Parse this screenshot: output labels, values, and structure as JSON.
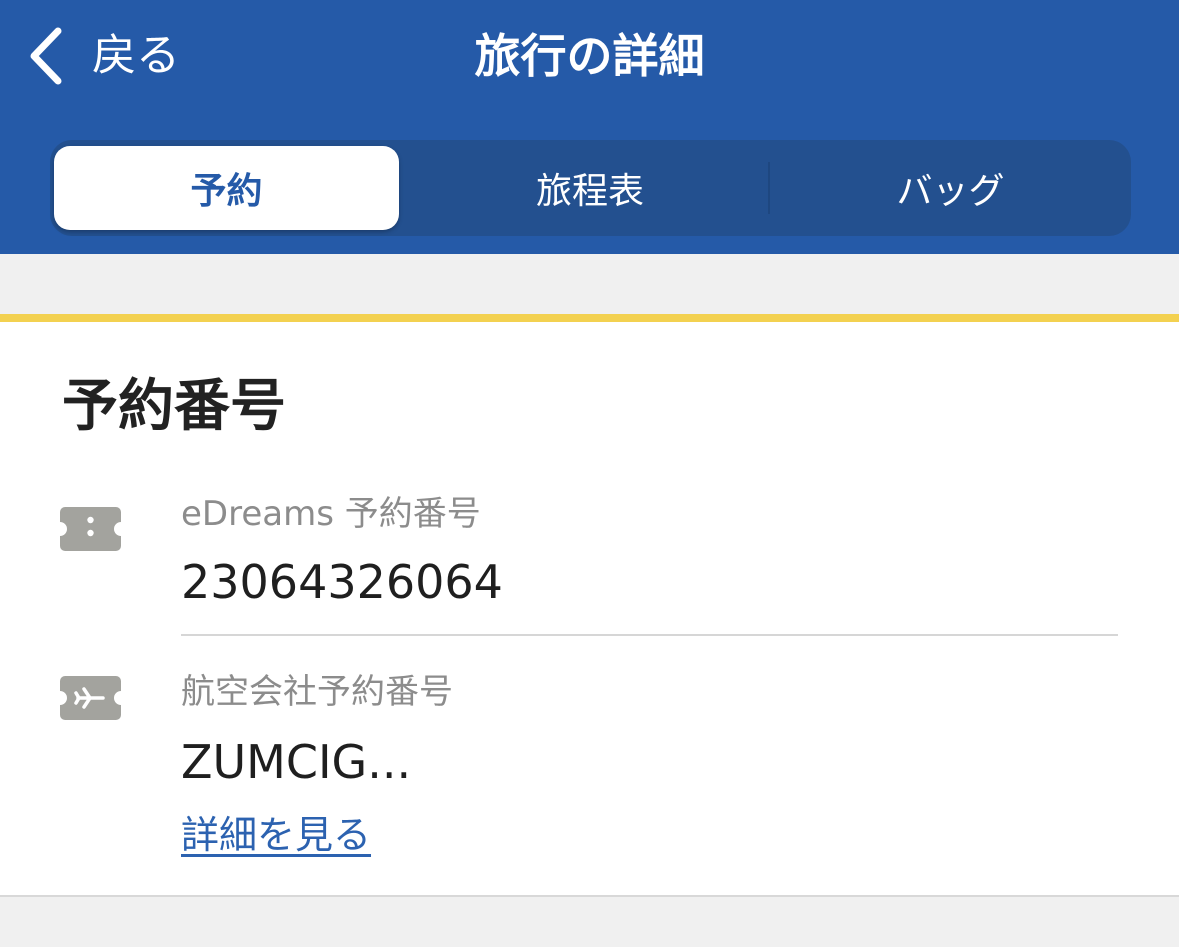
{
  "header": {
    "back_label": "戻る",
    "title": "旅行の詳細",
    "background_color": "#255aa8"
  },
  "tabs": [
    {
      "label": "予約",
      "active": true
    },
    {
      "label": "旅程表",
      "active": false
    },
    {
      "label": "バッグ",
      "active": false
    }
  ],
  "booking": {
    "section_title": "予約番号",
    "accent_color": "#f3d150",
    "rows": [
      {
        "icon": "ticket-icon",
        "label": "eDreams 予約番号",
        "value": "23064326064"
      },
      {
        "icon": "airline-ticket-icon",
        "label": "航空会社予約番号",
        "value": "ZUMCIG..."
      }
    ],
    "details_link": "詳細を見る"
  }
}
